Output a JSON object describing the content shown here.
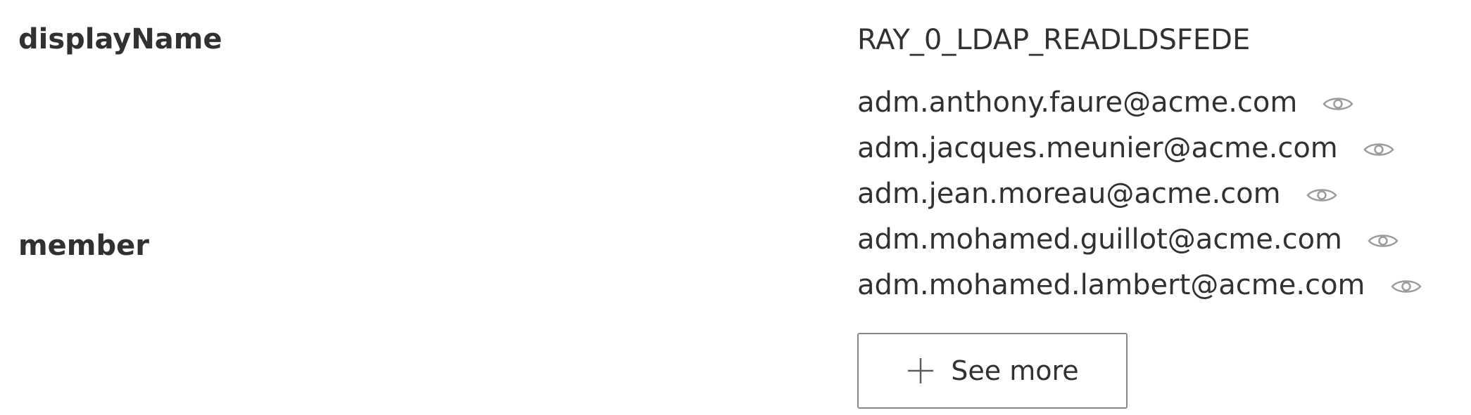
{
  "properties": {
    "display_name": {
      "label": "displayName",
      "value": "RAY_0_LDAP_READLDSFEDE"
    },
    "member": {
      "label": "member",
      "values": [
        "adm.anthony.faure@acme.com",
        "adm.jacques.meunier@acme.com",
        "adm.jean.moreau@acme.com",
        "adm.mohamed.guillot@acme.com",
        "adm.mohamed.lambert@acme.com"
      ],
      "row_icon": "eye-icon",
      "see_more": {
        "icon": "plus-icon",
        "label": "See more"
      }
    }
  },
  "colors": {
    "text": "#323130",
    "icon": "#8a8886",
    "button_border": "#8a8886",
    "background": "#ffffff"
  }
}
